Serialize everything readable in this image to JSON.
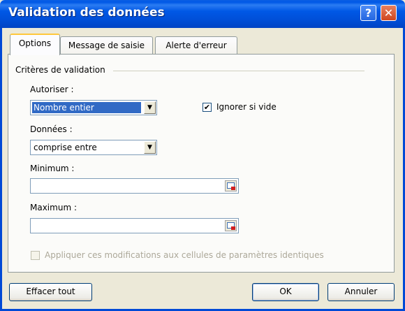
{
  "window": {
    "title": "Validation des données",
    "help_label": "?",
    "close_label": "✕"
  },
  "tabs": [
    {
      "label": "Options",
      "active": true
    },
    {
      "label": "Message de saisie",
      "active": false
    },
    {
      "label": "Alerte d'erreur",
      "active": false
    }
  ],
  "criteria": {
    "group_label": "Critères de validation",
    "allow_label": "Autoriser :",
    "allow_value": "Nombre entier",
    "ignore_blank_label": "Ignorer si vide",
    "ignore_blank_checked": true,
    "data_label": "Données :",
    "data_value": "comprise entre",
    "minimum_label": "Minimum :",
    "minimum_value": "",
    "maximum_label": "Maximum :",
    "maximum_value": "",
    "apply_all_label": "Appliquer ces modifications aux cellules de paramètres identiques",
    "apply_all_checked": false
  },
  "buttons": {
    "clear_all": "Effacer tout",
    "ok": "OK",
    "cancel": "Annuler"
  },
  "icons": {
    "combo_arrow": "dropdown-arrow-icon",
    "range_picker": "range-selector-icon",
    "checkmark": "✔"
  }
}
